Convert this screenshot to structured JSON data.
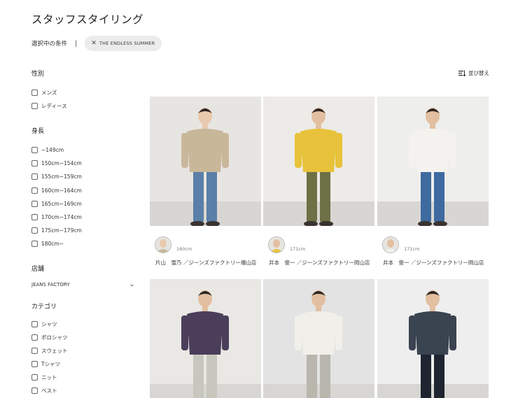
{
  "page": {
    "title": "スタッフスタイリング"
  },
  "conditions": {
    "label": "選択中の条件",
    "separator": "|",
    "chip": {
      "label": "THE ENDLESS SUMMER",
      "remove_icon": "close-icon"
    }
  },
  "sort": {
    "label": "並び替え",
    "icon": "sort-icon"
  },
  "filters": {
    "gender": {
      "title": "性別",
      "options": [
        "メンズ",
        "レディース"
      ]
    },
    "height": {
      "title": "身長",
      "options": [
        "~149cm",
        "150cm~154cm",
        "155cm~159cm",
        "160cm~164cm",
        "165cm~169cm",
        "170cm~174cm",
        "175cm~179cm",
        "180cm~"
      ]
    },
    "store": {
      "title": "店舗",
      "selected": "JEANS FACTORY",
      "icon": "chevron-down-icon"
    },
    "category": {
      "title": "カテゴリ",
      "options": [
        "シャツ",
        "ポロシャツ",
        "スウェット",
        "Tシャツ",
        "ニット",
        "ベスト"
      ]
    }
  },
  "cards": [
    {
      "height": "160cm",
      "staff": "片山　雪乃 ／ジーンズファクトリー福山店",
      "palette": {
        "bg": "#e7e5e2",
        "top": "#c9b79a",
        "bottom": "#5a7fa8",
        "skin": "#e9c9ae"
      }
    },
    {
      "height": "171cm",
      "staff": "井本　俊一 ／ジーンズファクトリー岡山店",
      "palette": {
        "bg": "#ecebe8",
        "top": "#e8c23a",
        "bottom": "#6e7145",
        "skin": "#e2bfa0"
      }
    },
    {
      "height": "171cm",
      "staff": "井本　俊一 ／ジーンズファクトリー岡山店",
      "palette": {
        "bg": "#eeeeec",
        "top": "#f4f2ee",
        "bottom": "#3e6aa0",
        "skin": "#e2bfa0"
      }
    },
    {
      "height": "",
      "staff": "",
      "palette": {
        "bg": "#e9e8e4",
        "top": "#4a3e5a",
        "bottom": "#c7c7bd",
        "skin": "#e2bfa0"
      }
    },
    {
      "height": "",
      "staff": "",
      "palette": {
        "bg": "#e3e3e3",
        "top": "#f0efe9",
        "bottom": "#b8b6ad",
        "skin": "#e2bfa0"
      }
    },
    {
      "height": "",
      "staff": "",
      "palette": {
        "bg": "#eeeeee",
        "top": "#3a4350",
        "bottom": "#1f2530",
        "skin": "#e2bfa0"
      }
    }
  ]
}
